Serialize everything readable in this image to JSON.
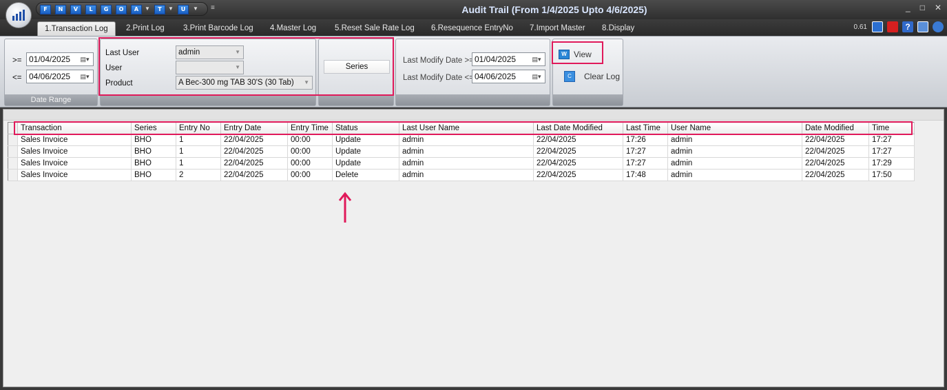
{
  "window": {
    "title": "Audit Trail (From 1/4/2025 Upto 4/6/2025)",
    "controls": [
      "_",
      "□",
      "✕"
    ]
  },
  "quick_access": [
    {
      "label": "F"
    },
    {
      "label": "N"
    },
    {
      "label": "V"
    },
    {
      "label": "L"
    },
    {
      "label": "G"
    },
    {
      "label": "O"
    },
    {
      "label": "A"
    },
    {
      "label": "T"
    },
    {
      "label": "U"
    }
  ],
  "tabs": [
    {
      "label": "1.Transaction Log",
      "active": true
    },
    {
      "label": "2.Print Log"
    },
    {
      "label": "3.Print Barcode Log"
    },
    {
      "label": "4.Master Log"
    },
    {
      "label": "5.Reset Sale Rate Log"
    },
    {
      "label": "6.Resequence EntryNo"
    },
    {
      "label": "7.Import Master"
    },
    {
      "label": "8.Display"
    }
  ],
  "version": "0.61",
  "toolbar_icons": [
    "network-icon",
    "youtube-icon",
    "help-icon",
    "notes-icon",
    "info-icon"
  ],
  "date_range": {
    "from_label": ">=",
    "from_value": "01/04/2025",
    "to_label": "<=",
    "to_value": "04/06/2025",
    "group_label": "Date Range"
  },
  "filters": {
    "last_user_label": "Last User",
    "last_user_value": "admin",
    "user_label": "User",
    "user_value": "",
    "product_label": "Product",
    "product_value": "A Bec-300 mg TAB 30'S (30 Tab)"
  },
  "series_button": "Series",
  "modify": {
    "from_label": "Last Modify Date >=",
    "from_value": "01/04/2025",
    "to_label": "Last Modify Date <=",
    "to_value": "04/06/2025"
  },
  "actions": {
    "view_label": "View",
    "clear_label": "Clear Log"
  },
  "table": {
    "columns": [
      "Transaction",
      "Series",
      "Entry No",
      "Entry Date",
      "Entry Time",
      "Status",
      "Last User Name",
      "Last Date Modified",
      "Last Time",
      "User Name",
      "Date Modified",
      "Time"
    ],
    "rows": [
      [
        "Sales Invoice",
        "BHO",
        "1",
        "22/04/2025",
        "00:00",
        "Update",
        "admin",
        "22/04/2025",
        "17:26",
        "admin",
        "22/04/2025",
        "17:27"
      ],
      [
        "Sales Invoice",
        "BHO",
        "1",
        "22/04/2025",
        "00:00",
        "Update",
        "admin",
        "22/04/2025",
        "17:27",
        "admin",
        "22/04/2025",
        "17:27"
      ],
      [
        "Sales Invoice",
        "BHO",
        "1",
        "22/04/2025",
        "00:00",
        "Update",
        "admin",
        "22/04/2025",
        "17:27",
        "admin",
        "22/04/2025",
        "17:29"
      ],
      [
        "Sales Invoice",
        "BHO",
        "2",
        "22/04/2025",
        "00:00",
        "Delete",
        "admin",
        "22/04/2025",
        "17:48",
        "admin",
        "22/04/2025",
        "17:50"
      ]
    ]
  },
  "colors": {
    "highlight": "#e0195a",
    "title_text": "#d9e6ff"
  }
}
